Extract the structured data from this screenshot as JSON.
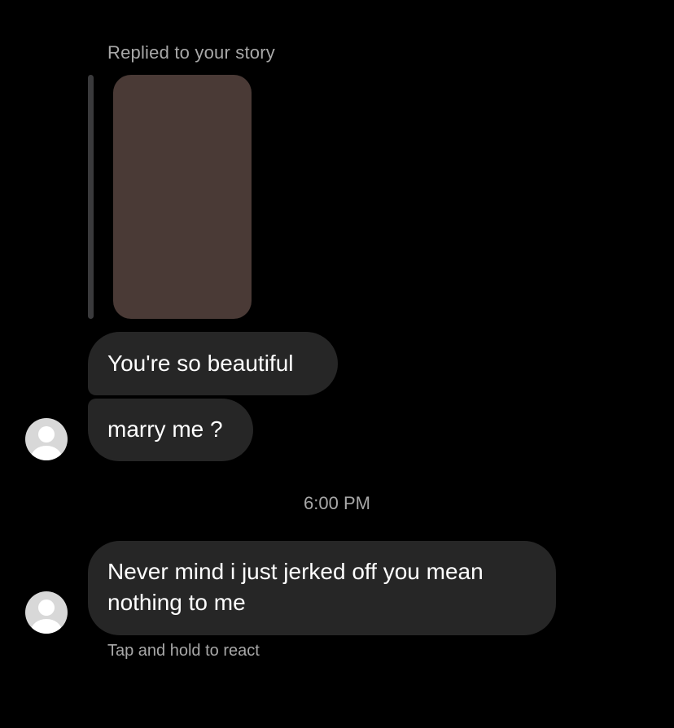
{
  "story_reply": {
    "label": "Replied to your story"
  },
  "messages": [
    {
      "text": "You're so beautiful"
    },
    {
      "text": "marry me ?"
    },
    {
      "text": "Never mind i just jerked off you mean nothing to me"
    }
  ],
  "timestamp": "6:00 PM",
  "react_hint": "Tap and hold to react",
  "colors": {
    "background": "#000000",
    "bubble": "#262626",
    "secondary_text": "#a8a8a8",
    "reply_bar": "#3a3a3c"
  }
}
